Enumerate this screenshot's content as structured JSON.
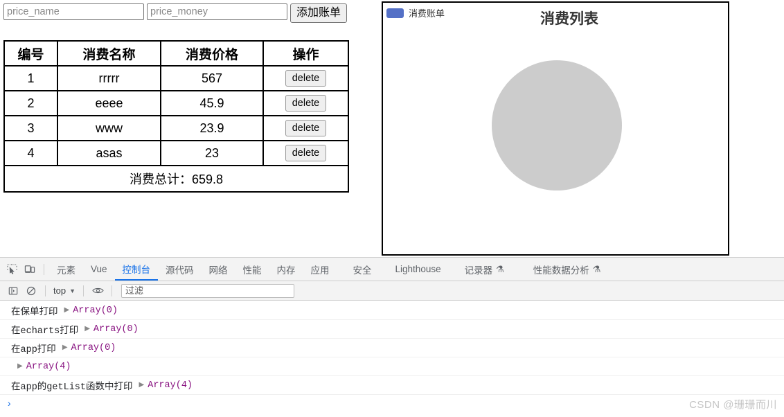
{
  "app": {
    "form": {
      "name_placeholder": "price_name",
      "name_value": "",
      "money_placeholder": "price_money",
      "money_value": "",
      "add_button": "添加账单"
    },
    "table": {
      "headers": [
        "编号",
        "消费名称",
        "消费价格",
        "操作"
      ],
      "rows": [
        {
          "id": "1",
          "name": "rrrrr",
          "price": "567",
          "action": "delete"
        },
        {
          "id": "2",
          "name": "eeee",
          "price": "45.9",
          "action": "delete"
        },
        {
          "id": "3",
          "name": "www",
          "price": "23.9",
          "action": "delete"
        },
        {
          "id": "4",
          "name": "asas",
          "price": "23",
          "action": "delete"
        }
      ],
      "total_label": "消费总计：659.8"
    }
  },
  "chart_data": {
    "type": "pie",
    "title": "消费列表",
    "legend": [
      "消费账单"
    ],
    "legend_position": "top-left",
    "legend_color": "#5470c6",
    "categories": [],
    "values": [],
    "empty_placeholder_color": "#cccccc"
  },
  "devtools": {
    "toolbar": {
      "inspect_icon": "inspect-element-icon",
      "device_icon": "device-toolbar-icon",
      "tabs": [
        {
          "label": "元素",
          "active": false,
          "flask": ""
        },
        {
          "label": "Vue",
          "active": false,
          "flask": ""
        },
        {
          "label": "控制台",
          "active": true,
          "flask": ""
        },
        {
          "label": "源代码",
          "active": false,
          "flask": ""
        },
        {
          "label": "网络",
          "active": false,
          "flask": ""
        },
        {
          "label": "性能",
          "active": false,
          "flask": ""
        },
        {
          "label": "内存",
          "active": false,
          "flask": ""
        },
        {
          "label": "应用",
          "active": false,
          "flask": ""
        },
        {
          "label": "安全",
          "active": false,
          "flask": ""
        },
        {
          "label": "Lighthouse",
          "active": false,
          "flask": ""
        },
        {
          "label": "记录器",
          "active": false,
          "flask": "⚗"
        },
        {
          "label": "性能数据分析",
          "active": false,
          "flask": "⚗"
        }
      ]
    },
    "filterbar": {
      "sidebar_icon": "console-sidebar-icon",
      "clear_icon": "clear-console-icon",
      "context": "top",
      "eye_icon": "live-expression-icon",
      "filter_placeholder": "过滤",
      "filter_value": ""
    },
    "console": {
      "logs": [
        {
          "message": "在保单打印",
          "object": "Array(0)"
        },
        {
          "message": "在echarts打印",
          "object": "Array(0)"
        },
        {
          "message": "在app打印",
          "object": "Array(0)"
        },
        {
          "message": "",
          "object": "Array(4)"
        },
        {
          "message": "在app的getList函数中打印",
          "object": "Array(4)"
        }
      ],
      "prompt": "›"
    }
  },
  "watermark": "CSDN @珊珊而川"
}
